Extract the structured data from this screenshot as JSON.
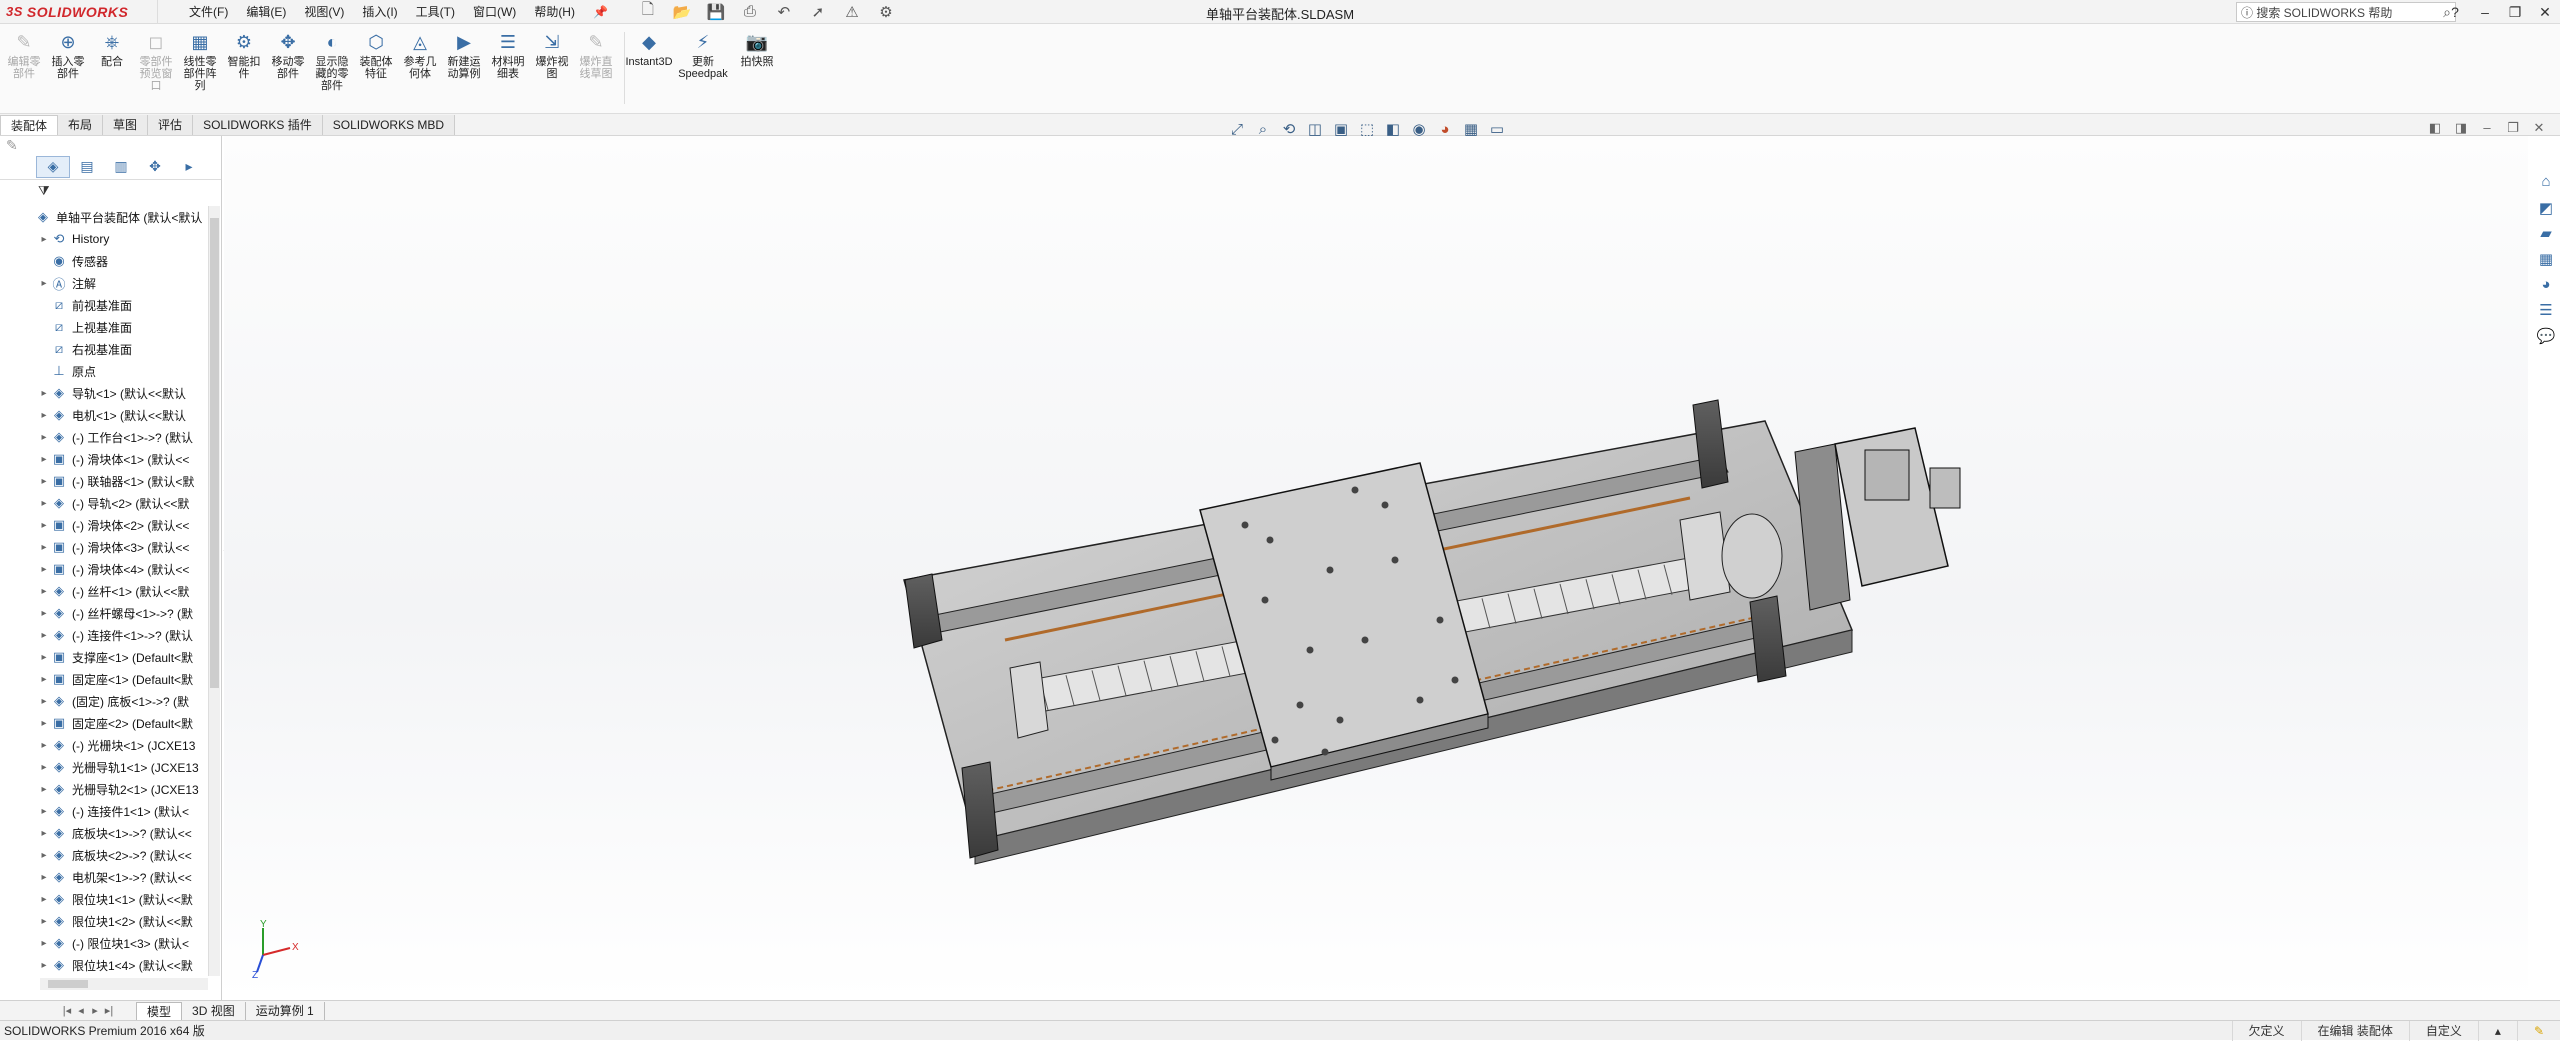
{
  "app": {
    "logo_ds": "3S",
    "logo_name": "SOLIDWORKS",
    "document_title": "单轴平台装配体.SLDASM"
  },
  "menu": [
    "文件(F)",
    "编辑(E)",
    "视图(V)",
    "插入(I)",
    "工具(T)",
    "窗口(W)",
    "帮助(H)"
  ],
  "search": {
    "placeholder": "搜索 SOLIDWORKS 帮助"
  },
  "ribbon": {
    "buttons": [
      {
        "label": "编辑零部件",
        "enabled": false
      },
      {
        "label": "插入零部件",
        "enabled": true
      },
      {
        "label": "配合",
        "enabled": true
      },
      {
        "label": "零部件预览窗口",
        "enabled": false
      },
      {
        "label": "线性零部件阵列",
        "enabled": true
      },
      {
        "label": "智能扣件",
        "enabled": true
      },
      {
        "label": "移动零部件",
        "enabled": true
      },
      {
        "label": "显示隐藏的零部件",
        "enabled": true
      },
      {
        "label": "装配体特征",
        "enabled": true
      },
      {
        "label": "参考几何体",
        "enabled": true
      },
      {
        "label": "新建运动算例",
        "enabled": true
      },
      {
        "label": "材料明细表",
        "enabled": true
      },
      {
        "label": "爆炸视图",
        "enabled": true
      },
      {
        "label": "爆炸直线草图",
        "enabled": false
      },
      {
        "label": "Instant3D",
        "enabled": true
      },
      {
        "label": "更新Speedpak",
        "enabled": true
      },
      {
        "label": "拍快照",
        "enabled": true
      }
    ]
  },
  "command_tabs": [
    "装配体",
    "布局",
    "草图",
    "评估",
    "SOLIDWORKS 插件",
    "SOLIDWORKS MBD"
  ],
  "feature_tree": {
    "root": "单轴平台装配体 (默认<默认",
    "items": [
      {
        "label": "History",
        "expandable": true,
        "icon": "history-icon"
      },
      {
        "label": "传感器",
        "expandable": false,
        "icon": "sensor-icon"
      },
      {
        "label": "注解",
        "expandable": true,
        "icon": "annotation-icon"
      },
      {
        "label": "前视基准面",
        "expandable": false,
        "icon": "plane-icon"
      },
      {
        "label": "上视基准面",
        "expandable": false,
        "icon": "plane-icon"
      },
      {
        "label": "右视基准面",
        "expandable": false,
        "icon": "plane-icon"
      },
      {
        "label": "原点",
        "expandable": false,
        "icon": "origin-icon"
      },
      {
        "label": "导轨<1> (默认<<默认",
        "expandable": true,
        "icon": "part-icon"
      },
      {
        "label": "电机<1> (默认<<默认",
        "expandable": true,
        "icon": "part-icon"
      },
      {
        "label": "(-) 工作台<1>->? (默认",
        "expandable": true,
        "icon": "part-icon"
      },
      {
        "label": "(-) 滑块体<1> (默认<<",
        "expandable": true,
        "icon": "subassembly-icon"
      },
      {
        "label": "(-) 联轴器<1> (默认<默",
        "expandable": true,
        "icon": "subassembly-icon"
      },
      {
        "label": "(-) 导轨<2> (默认<<默",
        "expandable": true,
        "icon": "part-icon"
      },
      {
        "label": "(-) 滑块体<2> (默认<<",
        "expandable": true,
        "icon": "subassembly-icon"
      },
      {
        "label": "(-) 滑块体<3> (默认<<",
        "expandable": true,
        "icon": "subassembly-icon"
      },
      {
        "label": "(-) 滑块体<4> (默认<<",
        "expandable": true,
        "icon": "subassembly-icon"
      },
      {
        "label": "(-) 丝杆<1> (默认<<默",
        "expandable": true,
        "icon": "part-icon"
      },
      {
        "label": "(-) 丝杆螺母<1>->? (默",
        "expandable": true,
        "icon": "part-icon"
      },
      {
        "label": "(-) 连接件<1>->? (默认",
        "expandable": true,
        "icon": "part-icon"
      },
      {
        "label": "支撑座<1> (Default<默",
        "expandable": true,
        "icon": "subassembly-icon"
      },
      {
        "label": "固定座<1> (Default<默",
        "expandable": true,
        "icon": "subassembly-icon"
      },
      {
        "label": "(固定) 底板<1>->? (默",
        "expandable": true,
        "icon": "part-icon"
      },
      {
        "label": "固定座<2> (Default<默",
        "expandable": true,
        "icon": "subassembly-icon"
      },
      {
        "label": "(-) 光栅块<1> (JCXE13",
        "expandable": true,
        "icon": "part-icon"
      },
      {
        "label": "光栅导轨1<1> (JCXE13",
        "expandable": true,
        "icon": "part-icon"
      },
      {
        "label": "光栅导轨2<1> (JCXE13",
        "expandable": true,
        "icon": "part-icon"
      },
      {
        "label": "(-) 连接件1<1> (默认<",
        "expandable": true,
        "icon": "part-icon"
      },
      {
        "label": "底板块<1>->? (默认<<",
        "expandable": true,
        "icon": "part-icon"
      },
      {
        "label": "底板块<2>->? (默认<<",
        "expandable": true,
        "icon": "part-icon"
      },
      {
        "label": "电机架<1>->? (默认<<",
        "expandable": true,
        "icon": "part-icon"
      },
      {
        "label": "限位块1<1> (默认<<默",
        "expandable": true,
        "icon": "part-icon"
      },
      {
        "label": "限位块1<2> (默认<<默",
        "expandable": true,
        "icon": "part-icon"
      },
      {
        "label": "(-) 限位块1<3> (默认<",
        "expandable": true,
        "icon": "part-icon"
      },
      {
        "label": "限位块1<4> (默认<<默",
        "expandable": true,
        "icon": "part-icon"
      }
    ]
  },
  "triad": {
    "x": "X",
    "y": "Y",
    "z": "Z"
  },
  "bottom_tabs": [
    "模型",
    "3D 视图",
    "运动算例 1"
  ],
  "status": {
    "app_version": "SOLIDWORKS Premium 2016 x64 版",
    "defined": "欠定义",
    "editing": "在编辑 装配体",
    "custom": "自定义"
  },
  "colors": {
    "brand": "#d1272c",
    "accent": "#3a6ea5",
    "rail_copper": "#b06a2a"
  }
}
